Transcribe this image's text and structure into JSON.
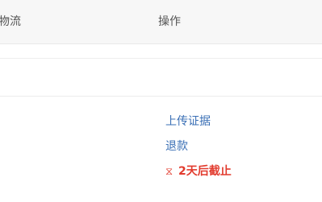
{
  "table": {
    "headers": {
      "logistics": "物流",
      "actions": "操作"
    },
    "row": {
      "actions": {
        "upload_evidence": "上传证据",
        "refund": "退款",
        "deadline_icon": "hourglass-icon",
        "deadline_text": "2天后截止"
      }
    }
  },
  "colors": {
    "link": "#3a6fb5",
    "deadline": "#e23b2e",
    "header_bg": "#f7f7f7"
  }
}
